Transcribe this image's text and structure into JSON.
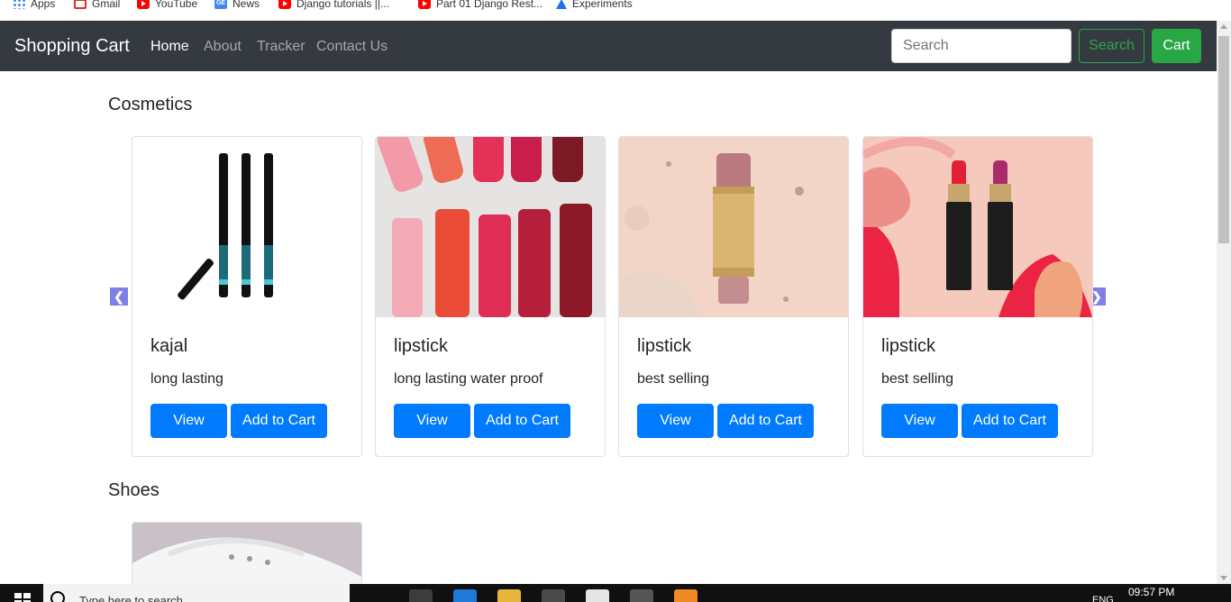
{
  "bookmarks": [
    {
      "label": "Apps",
      "icon": "apps-grid-icon"
    },
    {
      "label": "Gmail",
      "icon": "gmail-icon"
    },
    {
      "label": "YouTube",
      "icon": "youtube-icon"
    },
    {
      "label": "News",
      "icon": "google-news-icon"
    },
    {
      "label": "Django tutorials ||...",
      "icon": "youtube-icon"
    },
    {
      "label": "Part 01 Django Rest...",
      "icon": "youtube-icon"
    },
    {
      "label": "Experiments",
      "icon": "experiments-icon"
    }
  ],
  "navbar": {
    "brand": "Shopping Cart",
    "links": [
      {
        "label": "Home",
        "active": true
      },
      {
        "label": "About",
        "active": false
      },
      {
        "label": "Tracker",
        "active": false
      },
      {
        "label": "Contact Us",
        "active": false
      }
    ],
    "search_placeholder": "Search",
    "search_button": "Search",
    "cart_button": "Cart"
  },
  "sections": [
    {
      "title": "Cosmetics",
      "products": [
        {
          "name": "kajal",
          "description": "long lasting",
          "view_label": "View",
          "add_label": "Add to Cart",
          "image": "kajal-pencils-image"
        },
        {
          "name": "lipstick",
          "description": "long lasting water proof",
          "view_label": "View",
          "add_label": "Add to Cart",
          "image": "lipsticks-collection-image"
        },
        {
          "name": "lipstick",
          "description": "best selling",
          "view_label": "View",
          "add_label": "Add to Cart",
          "image": "lip-stick-tube-image"
        },
        {
          "name": "lipstick",
          "description": "best selling",
          "view_label": "View",
          "add_label": "Add to Cart",
          "image": "two-lipsticks-image"
        }
      ]
    },
    {
      "title": "Shoes",
      "products": [
        {
          "image": "white-sneaker-image"
        }
      ]
    }
  ],
  "taskbar": {
    "search_placeholder": "Type here to search",
    "time": "09:57 PM",
    "language": "ENG"
  },
  "colors": {
    "navbar_bg": "#343a40",
    "primary": "#007bff",
    "success": "#28a745",
    "carousel_arrow": "#7f7fe8"
  }
}
